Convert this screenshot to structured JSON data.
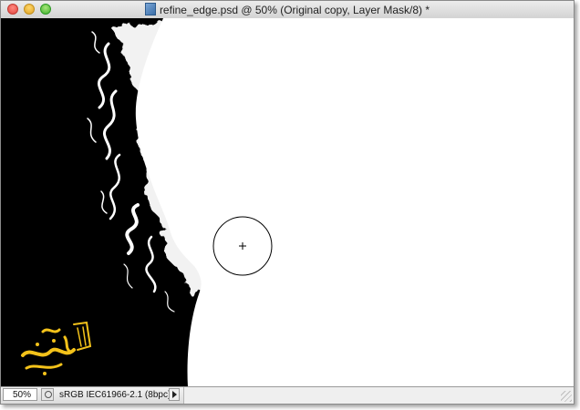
{
  "window": {
    "title": "refine_edge.psd @ 50% (Original copy, Layer Mask/8) *"
  },
  "canvas": {
    "cursor_icon": "brush-circle-cursor-icon",
    "logo_text": "تدزنیس وب",
    "logo_color": "#f3c21a"
  },
  "statusbar": {
    "zoom": "50%",
    "doc_info": "sRGB IEC61966-2.1 (8bpc)"
  }
}
